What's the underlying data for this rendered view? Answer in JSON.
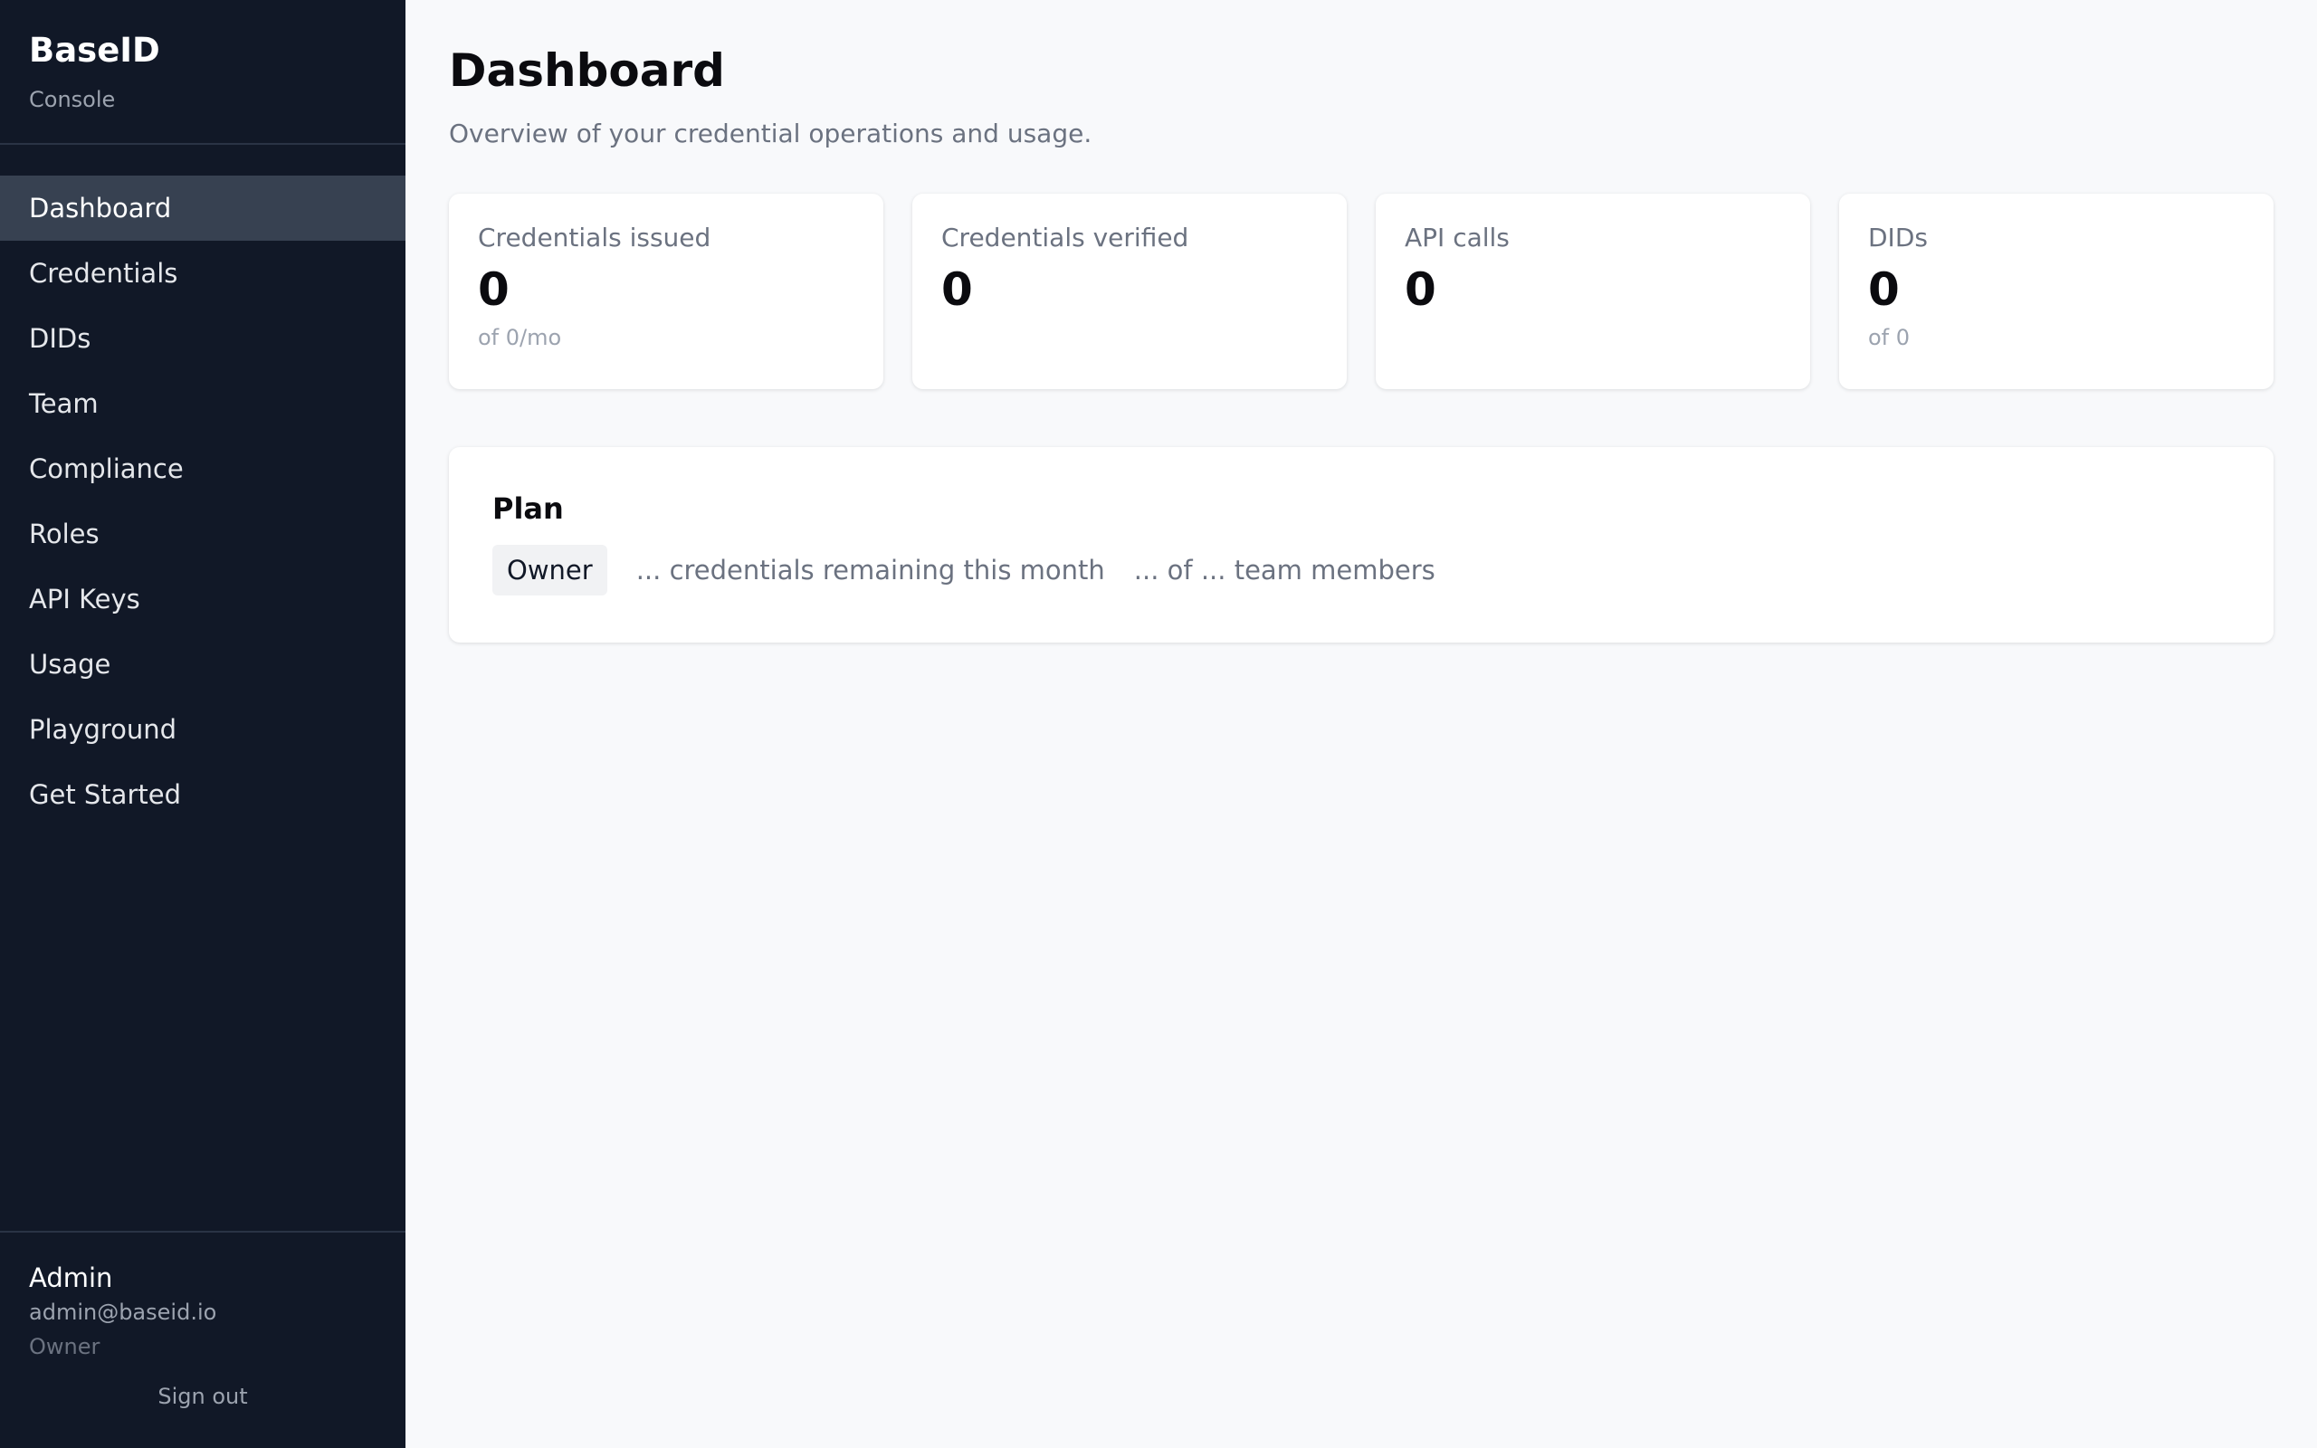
{
  "brand": {
    "name": "BaseID",
    "subtitle": "Console"
  },
  "sidebar": {
    "items": [
      {
        "label": "Dashboard",
        "active": true
      },
      {
        "label": "Credentials",
        "active": false
      },
      {
        "label": "DIDs",
        "active": false
      },
      {
        "label": "Team",
        "active": false
      },
      {
        "label": "Compliance",
        "active": false
      },
      {
        "label": "Roles",
        "active": false
      },
      {
        "label": "API Keys",
        "active": false
      },
      {
        "label": "Usage",
        "active": false
      },
      {
        "label": "Playground",
        "active": false
      },
      {
        "label": "Get Started",
        "active": false
      }
    ]
  },
  "user": {
    "name": "Admin",
    "email": "admin@baseid.io",
    "role": "Owner",
    "signout_label": "Sign out"
  },
  "main": {
    "title": "Dashboard",
    "subtitle": "Overview of your credential operations and usage.",
    "stats": [
      {
        "label": "Credentials issued",
        "value": "0",
        "sub": "of 0/mo"
      },
      {
        "label": "Credentials verified",
        "value": "0",
        "sub": ""
      },
      {
        "label": "API calls",
        "value": "0",
        "sub": ""
      },
      {
        "label": "DIDs",
        "value": "0",
        "sub": "of 0"
      }
    ],
    "plan": {
      "title": "Plan",
      "badge": "Owner",
      "credentials_remaining": "... credentials remaining this month",
      "team_members": "... of ... team members"
    }
  },
  "colors": {
    "sidebar_bg": "#111827",
    "sidebar_active": "#374151",
    "page_bg": "#f8f9fb",
    "card_bg": "#ffffff",
    "muted_text": "#6b7280"
  }
}
